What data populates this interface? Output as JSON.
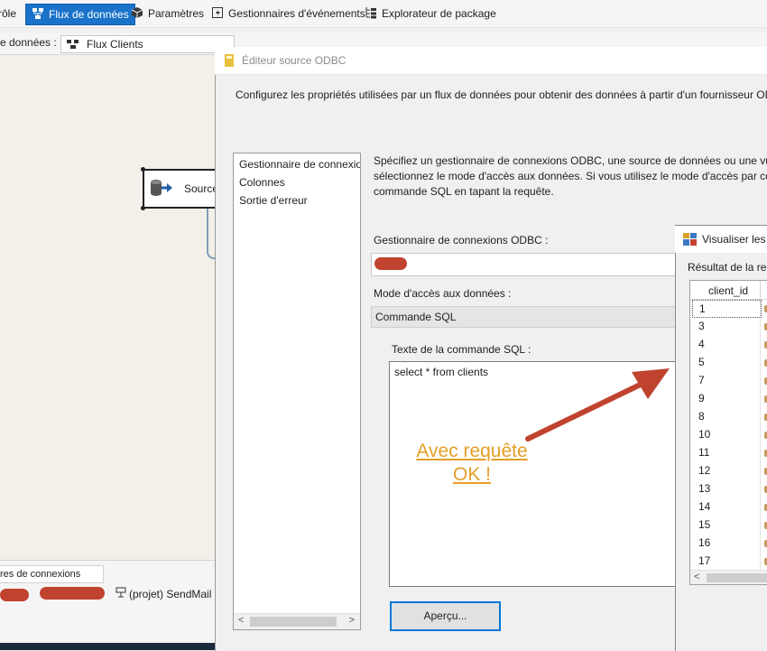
{
  "toolbar": {
    "tabs": [
      {
        "label": "rôle",
        "icon": "control-flow-icon"
      },
      {
        "label": "Flux de données",
        "icon": "data-flow-icon",
        "active": true
      },
      {
        "label": "Paramètres",
        "icon": "parameters-icon"
      },
      {
        "label": "Gestionnaires d'événements",
        "icon": "event-handlers-icon"
      },
      {
        "label": "Explorateur de package",
        "icon": "package-explorer-icon"
      }
    ]
  },
  "dataflow_selector": {
    "label": "e données :",
    "value": "Flux Clients"
  },
  "canvas": {
    "component_label": "Source"
  },
  "bottom_panel": {
    "tab_label": "res de connexions",
    "connection_label": "(projet) SendMail"
  },
  "odbc_editor": {
    "title": "Éditeur source ODBC",
    "description": "Configurez les propriétés utilisées par un flux de données pour obtenir des données à partir d'un fournisseur ODBC.",
    "nav_items": [
      "Gestionnaire de connexions",
      "Colonnes",
      "Sortie d'erreur"
    ],
    "instruction_lines": [
      "Spécifiez un gestionnaire de connexions ODBC, une source de données ou une vue",
      "sélectionnez le mode d'accès aux données. Si vous utilisez le mode d'accès par comm",
      "commande SQL en tapant la requête."
    ],
    "connection_manager_label": "Gestionnaire de connexions ODBC :",
    "access_mode_label": "Mode d'accès aux données :",
    "access_mode_value": "Commande SQL",
    "sql_label": "Texte de la commande SQL :",
    "sql_text": "select * from clients",
    "preview_button": "Aperçu..."
  },
  "annotation": {
    "line1": "Avec requête",
    "line2": "OK !",
    "color": "#e39f28",
    "arrow_color": "#c0432f"
  },
  "preview_window": {
    "title": "Visualiser les r",
    "result_label": "Résultat de la rec",
    "column_header": "client_id",
    "rows": [
      "1",
      "3",
      "4",
      "5",
      "7",
      "9",
      "8",
      "10",
      "11",
      "12",
      "13",
      "14",
      "15",
      "16",
      "17"
    ]
  }
}
